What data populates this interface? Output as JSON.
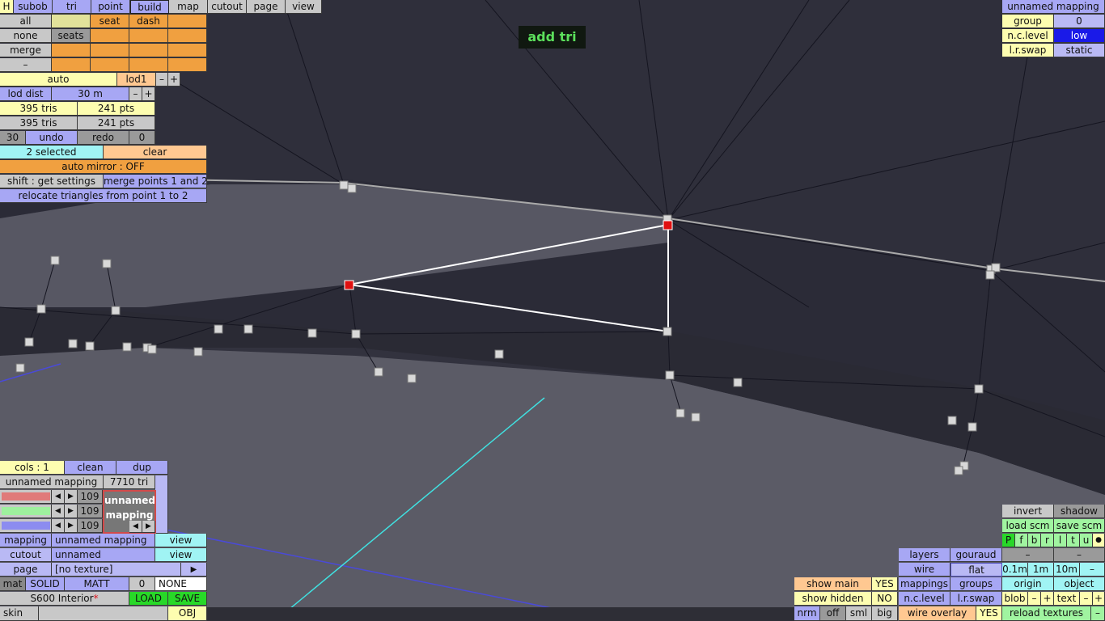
{
  "overlay_title": "add tri",
  "topbar": {
    "h": "H",
    "tabs": [
      "subob",
      "tri",
      "point",
      "build",
      "map",
      "cutout",
      "page",
      "view"
    ],
    "active_tab": "build"
  },
  "selection": {
    "all": "all",
    "none": "none",
    "merge": "merge",
    "minus": "–",
    "seat": "seat",
    "dash": "dash",
    "seats": "seats"
  },
  "lod": {
    "auto": "auto",
    "level": "lod1",
    "minus": "–",
    "plus": "+",
    "dist_label": "lod dist",
    "dist_value": "30 m",
    "tris1": "395 tris",
    "pts1": "241 pts",
    "tris2": "395 tris",
    "pts2": "241 pts"
  },
  "history": {
    "count": "30",
    "undo": "undo",
    "redo": "redo",
    "redo_count": "0"
  },
  "sel_info": {
    "selected": "2 selected",
    "clear": "clear"
  },
  "mirror": "auto mirror : OFF",
  "actions": {
    "shift": "shift : get settings",
    "merge_points": "merge points 1 and 2",
    "relocate": "relocate triangles from point 1 to 2"
  },
  "top_right": {
    "mapping_name": "unnamed mapping",
    "group_label": "group",
    "group_value": "0",
    "nc_level_label": "n.c.level",
    "nc_level_value": "low",
    "lr_swap_label": "l.r.swap",
    "lr_swap_value": "static"
  },
  "mapping_panel": {
    "cols": "cols : 1",
    "clean": "clean",
    "dup": "dup",
    "name": "unnamed mapping",
    "tri_count": "7710 tri",
    "r": "109",
    "g": "109",
    "b": "109",
    "preview_line1": "unnamed",
    "preview_line2": "mapping",
    "mapping_label": "mapping",
    "mapping_value": "unnamed mapping",
    "mapping_view": "view",
    "cutout_label": "cutout",
    "cutout_value": "unnamed",
    "cutout_view": "view",
    "page_label": "page",
    "page_value": "[no texture]",
    "page_arrow": "▶",
    "mat": "mat",
    "solid": "SOLID",
    "matt": "MATT",
    "mat_num": "0",
    "none": "NONE",
    "model": "S600 Interior",
    "asterisk": "*",
    "load": "LOAD",
    "save": "SAVE",
    "skin": "skin",
    "obj": "OBJ"
  },
  "bottom_right": {
    "invert": "invert",
    "shadow": "shadow",
    "load_scm": "load scm",
    "save_scm": "save scm",
    "flags": [
      "P",
      "f",
      "b",
      "r",
      "l",
      "t",
      "u",
      "●"
    ],
    "layers": "layers",
    "gouraud": "gouraud",
    "dash1": "–",
    "dash2": "–",
    "wire": "wire",
    "flat": "flat",
    "s01": "0.1m",
    "s1": "1m",
    "s10": "10m",
    "sdash": "–",
    "show_main": "show main",
    "show_main_val": "YES",
    "mappings": "mappings",
    "groups": "groups",
    "origin": "origin",
    "object": "object",
    "show_hidden": "show hidden",
    "show_hidden_val": "NO",
    "nc_level": "n.c.level",
    "lr_swap": "l.r.swap",
    "blob": "blob",
    "text": "text",
    "bminus": "–",
    "bplus": "+",
    "nrm": "nrm",
    "off": "off",
    "sml": "sml",
    "big": "big",
    "wire_overlay": "wire overlay",
    "wire_overlay_val": "YES",
    "reload": "reload textures",
    "rdash": "–"
  },
  "colors": {
    "background": "#31313c",
    "selected_point": "#e01010",
    "active_tab": "#a7a7f4"
  }
}
